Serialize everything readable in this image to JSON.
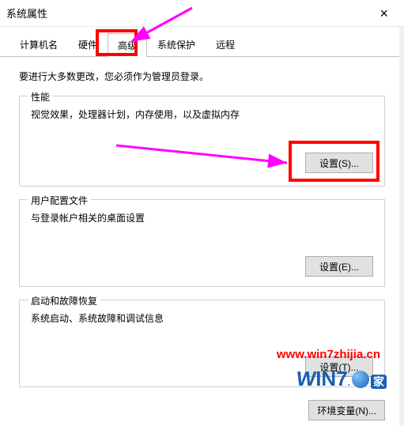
{
  "title": "系统属性",
  "tabs": {
    "computer_name": "计算机名",
    "hardware": "硬件",
    "advanced": "高级",
    "system_protection": "系统保护",
    "remote": "远程"
  },
  "hint": "要进行大多数更改，您必须作为管理员登录。",
  "performance": {
    "legend": "性能",
    "text": "视觉效果，处理器计划，内存使用，以及虚拟内存",
    "button": "设置(S)..."
  },
  "user_profiles": {
    "legend": "用户配置文件",
    "text": "与登录帐户相关的桌面设置",
    "button": "设置(E)..."
  },
  "startup": {
    "legend": "启动和故障恢复",
    "text": "系统启动、系统故障和调试信息",
    "button": "设置(T)..."
  },
  "env_button": "环境变量(N)...",
  "watermark_url": "www.win7zhijia.cn"
}
